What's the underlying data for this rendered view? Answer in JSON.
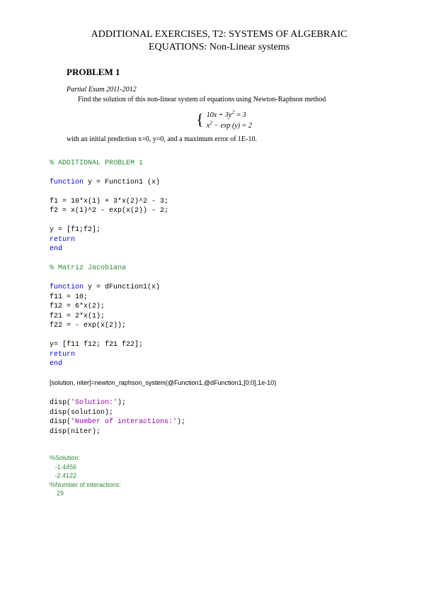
{
  "title_line1": "ADDITIONAL EXERCISES, T2: SYSTEMS OF ALGEBRAIC",
  "title_line2": "EQUATIONS: Non-Linear systems",
  "problem_heading": "PROBLEM 1",
  "exam_line": "Partial Exam 2011-2012",
  "desc_line": "Find the solution of this non-linear system of equations using Newton-Raphson method",
  "eq1": "10x + 3y",
  "eq1b": " = 3",
  "eq2a": "x",
  "eq2b": " − exp (y) = 2",
  "initial_cond": "with an initial prediction x=0, y=0, and a maximum error of 1E-10.",
  "code": {
    "c1": "% ADDITIONAL PROBLEM 1",
    "fn1_sig": " y = Function1 (x)",
    "f1": "f1 = 10*x(1) + 3*x(2)^2 - 3;",
    "f2": "f2 = x(1)^2 - exp(x(2)) - 2;",
    "yassign": "y = [f1;f2];",
    "c2": "% Matriz Jacobiana",
    "fn2_sig": " y = dFunction1(x)",
    "f11": "f11 = 10;",
    "f12": "f12 = 6*x(2);",
    "f21": "f21 = 2*x(1);",
    "f22": "f22 = - exp(x(2));",
    "yassign2": "y= [f11 f12; f21 f22];",
    "call": "[solution, niter]=newton_raphson_system(@Function1,@dFunction1,[0;0],1e-10)",
    "d1a": "disp(",
    "d1s": "'Solution:'",
    "d1b": ");",
    "d2": "disp(solution);",
    "d3a": "disp(",
    "d3s": "'Number of interactions:'",
    "d3b": ");",
    "d4": "disp(niter);",
    "kw_function": "function",
    "kw_return": "return",
    "kw_end": "end"
  },
  "output": {
    "l1": "%Solution:",
    "l2": "-1.4456",
    "l3": "-2.4122",
    "l4": "%Number of interactions:",
    "l5": "29"
  }
}
